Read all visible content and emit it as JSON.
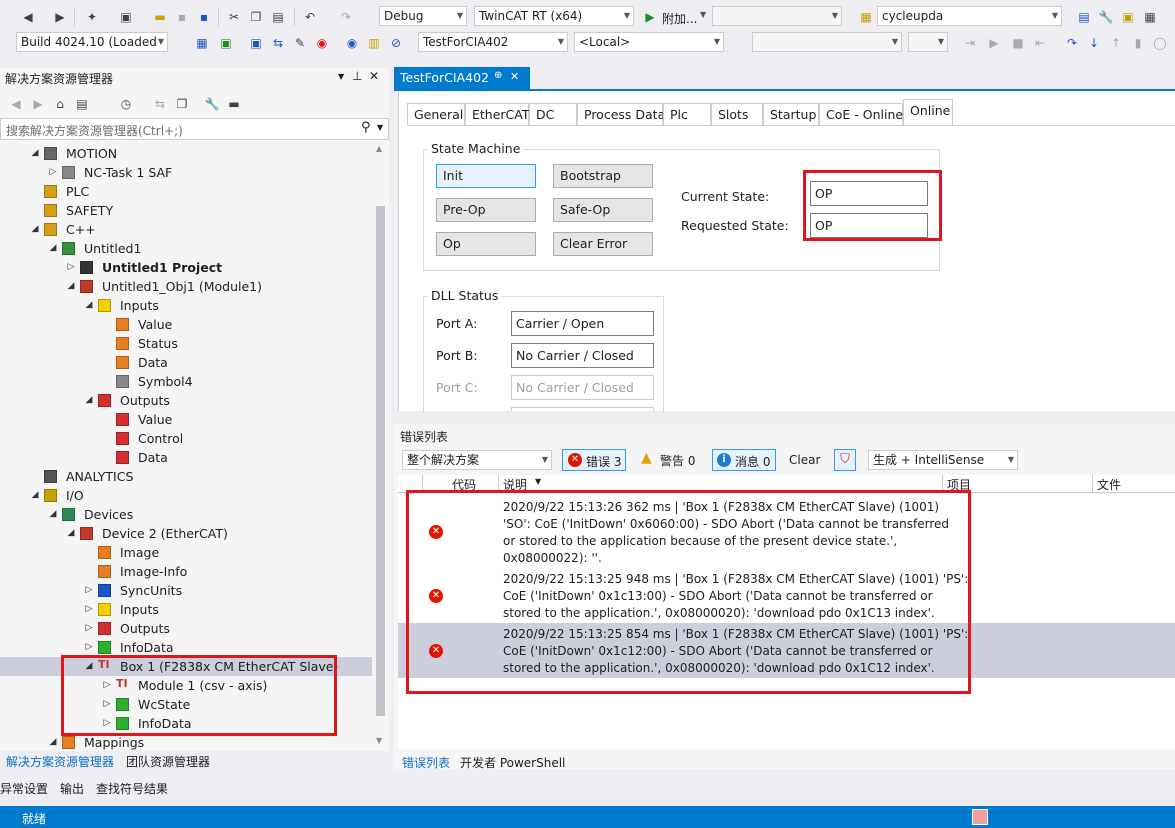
{
  "toolbar1": {
    "config": "Debug",
    "platform": "TwinCAT RT (x64)",
    "attach": "附加...",
    "find": "cycleupda"
  },
  "toolbar2": {
    "build": "Build 4024.10 (Loaded",
    "project": "TestForCIA402",
    "target": "<Local>"
  },
  "solution_explorer": {
    "title": "解决方案资源管理器",
    "search_placeholder": "搜索解决方案资源管理器(Ctrl+;)",
    "items": [
      {
        "label": "MOTION",
        "icon": "motion-icon",
        "depth": 0,
        "expand": "open"
      },
      {
        "label": "NC-Task 1 SAF",
        "icon": "nc-task-icon",
        "depth": 1,
        "expand": "closed"
      },
      {
        "label": "PLC",
        "icon": "plc-icon",
        "depth": 0,
        "expand": "none"
      },
      {
        "label": "SAFETY",
        "icon": "safety-icon",
        "depth": 0,
        "expand": "none"
      },
      {
        "label": "C++",
        "icon": "cpp-icon",
        "depth": 0,
        "expand": "open"
      },
      {
        "label": "Untitled1",
        "icon": "cpp-module-icon",
        "depth": 1,
        "expand": "open"
      },
      {
        "label": "Untitled1 Project",
        "icon": "project-icon",
        "depth": 2,
        "expand": "closed",
        "bold": true
      },
      {
        "label": "Untitled1_Obj1 (Module1)",
        "icon": "module-icon",
        "depth": 2,
        "expand": "open"
      },
      {
        "label": "Inputs",
        "icon": "inputs-folder-icon",
        "depth": 3,
        "expand": "open"
      },
      {
        "label": "Value",
        "icon": "input-var-icon",
        "depth": 4,
        "expand": "none"
      },
      {
        "label": "Status",
        "icon": "input-var-icon",
        "depth": 4,
        "expand": "none"
      },
      {
        "label": "Data",
        "icon": "input-var-icon",
        "depth": 4,
        "expand": "none"
      },
      {
        "label": "Symbol4",
        "icon": "symbol-icon",
        "depth": 4,
        "expand": "none"
      },
      {
        "label": "Outputs",
        "icon": "outputs-folder-icon",
        "depth": 3,
        "expand": "open"
      },
      {
        "label": "Value",
        "icon": "output-var-icon",
        "depth": 4,
        "expand": "none"
      },
      {
        "label": "Control",
        "icon": "output-var-icon",
        "depth": 4,
        "expand": "none"
      },
      {
        "label": "Data",
        "icon": "output-var-icon",
        "depth": 4,
        "expand": "none"
      },
      {
        "label": "ANALYTICS",
        "icon": "analytics-icon",
        "depth": 0,
        "expand": "none"
      },
      {
        "label": "I/O",
        "icon": "io-icon",
        "depth": 0,
        "expand": "open"
      },
      {
        "label": "Devices",
        "icon": "devices-icon",
        "depth": 1,
        "expand": "open"
      },
      {
        "label": "Device 2 (EtherCAT)",
        "icon": "ethercat-device-icon",
        "depth": 2,
        "expand": "open"
      },
      {
        "label": "Image",
        "icon": "image-icon",
        "depth": 3,
        "expand": "none"
      },
      {
        "label": "Image-Info",
        "icon": "image-info-icon",
        "depth": 3,
        "expand": "none"
      },
      {
        "label": "SyncUnits",
        "icon": "syncunits-icon",
        "depth": 3,
        "expand": "closed"
      },
      {
        "label": "Inputs",
        "icon": "inputs-folder-icon",
        "depth": 3,
        "expand": "closed"
      },
      {
        "label": "Outputs",
        "icon": "outputs-folder-icon",
        "depth": 3,
        "expand": "closed"
      },
      {
        "label": "InfoData",
        "icon": "infodata-icon",
        "depth": 3,
        "expand": "closed"
      },
      {
        "label": "Box 1 (F2838x CM EtherCAT Slave)",
        "icon": "ti-box-icon",
        "depth": 3,
        "expand": "open",
        "selected": true
      },
      {
        "label": "Module 1 (csv -   axis)",
        "icon": "ti-module-icon",
        "depth": 4,
        "expand": "closed"
      },
      {
        "label": "WcState",
        "icon": "wcstate-icon",
        "depth": 4,
        "expand": "closed"
      },
      {
        "label": "InfoData",
        "icon": "infodata-icon",
        "depth": 4,
        "expand": "closed"
      },
      {
        "label": "Mappings",
        "icon": "mappings-icon",
        "depth": 1,
        "expand": "open"
      }
    ],
    "bottom_tabs": [
      "解决方案资源管理器",
      "团队资源管理器"
    ]
  },
  "bottom_panel_tabs": [
    "异常设置",
    "输出",
    "查找符号结果"
  ],
  "status_bar": {
    "text": "就绪"
  },
  "editor": {
    "doc_tab": "TestForCIA402",
    "pin": "⊕",
    "close": "✕",
    "tabs": [
      "General",
      "EtherCAT",
      "DC",
      "Process Data",
      "Plc",
      "Slots",
      "Startup",
      "CoE - Online",
      "Online"
    ],
    "active_tab": "Online",
    "state_machine": {
      "title": "State Machine",
      "buttons": [
        "Init",
        "Bootstrap",
        "Pre-Op",
        "Safe-Op",
        "Op",
        "Clear Error"
      ],
      "current_state_label": "Current State:",
      "current_state": "OP",
      "requested_state_label": "Requested State:",
      "requested_state": "OP"
    },
    "dll_status": {
      "title": "DLL Status",
      "ports": [
        {
          "label": "Port A:",
          "value": "Carrier / Open",
          "disabled": false
        },
        {
          "label": "Port B:",
          "value": "No Carrier / Closed",
          "disabled": false
        },
        {
          "label": "Port C:",
          "value": "No Carrier / Closed",
          "disabled": true
        }
      ]
    }
  },
  "error_list": {
    "title": "错误列表",
    "scope": "整个解决方案",
    "errors_label": "错误 3",
    "warnings_label": "警告 0",
    "messages_label": "消息 0",
    "clear_label": "Clear",
    "build_filter": "生成 + IntelliSense",
    "columns": [
      "代码",
      "说明",
      "项目",
      "文件"
    ],
    "rows": [
      {
        "lines": [
          "2020/9/22 15:13:26 362 ms  | 'Box 1 (F2838x CM EtherCAT Slave) (1001)",
          "'SO': CoE ('InitDown' 0x6060:00) - SDO Abort ('Data cannot be transferred",
          "or stored to the application because of the present device state.',",
          "0x08000022): ''."
        ]
      },
      {
        "lines": [
          "2020/9/22 15:13:25 948 ms  | 'Box 1 (F2838x CM EtherCAT Slave) (1001) 'PS':",
          "CoE ('InitDown' 0x1c13:00) - SDO Abort ('Data cannot be transferred or",
          "stored to the application.', 0x08000020): 'download pdo 0x1C13 index'."
        ]
      },
      {
        "lines": [
          "2020/9/22 15:13:25 854 ms  | 'Box 1 (F2838x CM EtherCAT Slave) (1001) 'PS':",
          "CoE ('InitDown' 0x1c12:00) - SDO Abort ('Data cannot be transferred or",
          "stored to the application.', 0x08000020): 'download pdo 0x1C12 index'."
        ]
      }
    ],
    "bottom_tabs": [
      "错误列表",
      "开发者 PowerShell"
    ]
  }
}
